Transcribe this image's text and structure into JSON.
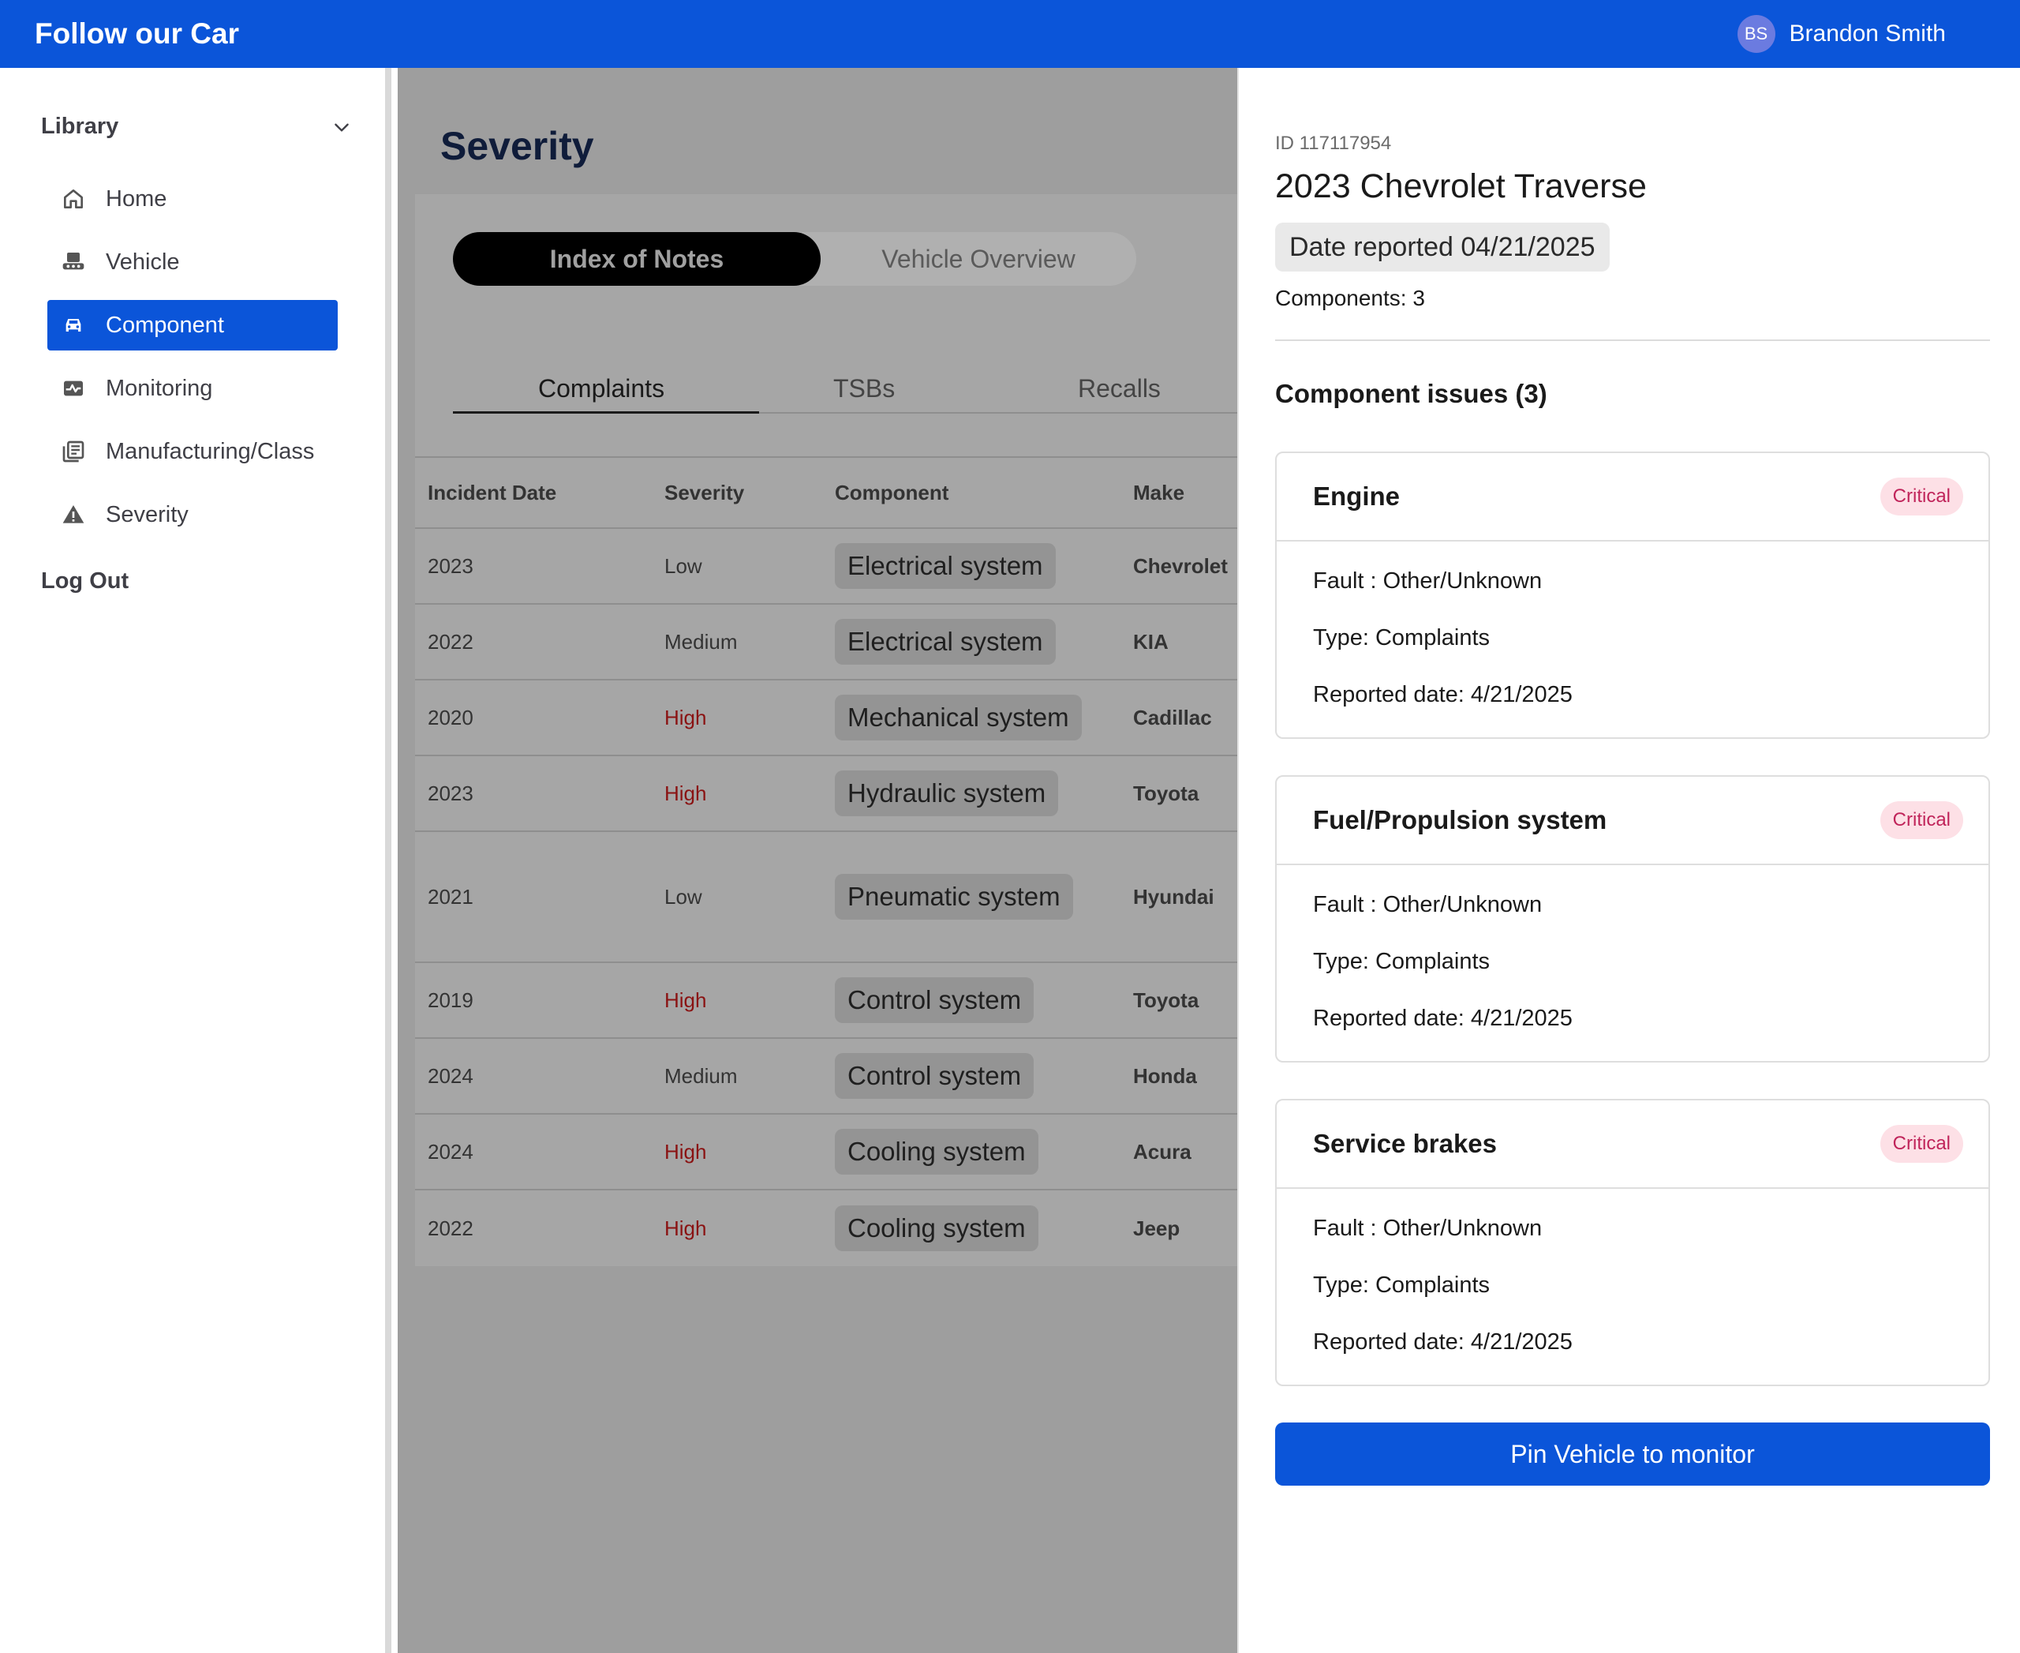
{
  "app": {
    "title": "Follow our Car"
  },
  "user": {
    "initials": "BS",
    "name": "Brandon Smith"
  },
  "sidebar": {
    "section_title": "Library",
    "items": [
      {
        "label": "Home",
        "icon": "home-icon"
      },
      {
        "label": "Vehicle",
        "icon": "vehicle-icon"
      },
      {
        "label": "Component",
        "icon": "car-icon",
        "active": true
      },
      {
        "label": "Monitoring",
        "icon": "monitoring-icon"
      },
      {
        "label": "Manufacturing/Class",
        "icon": "library-icon"
      },
      {
        "label": "Severity",
        "icon": "warning-icon"
      }
    ],
    "logout": "Log Out"
  },
  "main": {
    "title": "Severity",
    "segment": {
      "active": "Index of Notes",
      "inactive": "Vehicle Overview"
    },
    "tabs": [
      "Complaints",
      "TSBs",
      "Recalls"
    ],
    "columns": [
      "Incident Date",
      "Severity",
      "Component",
      "Make"
    ],
    "rows": [
      {
        "date": "2023",
        "severity": "Low",
        "component": "Electrical system",
        "make": "Chevrolet"
      },
      {
        "date": "2022",
        "severity": "Medium",
        "component": "Electrical system",
        "make": "KIA"
      },
      {
        "date": "2020",
        "severity": "High",
        "component": "Mechanical system",
        "make": "Cadillac"
      },
      {
        "date": "2023",
        "severity": "High",
        "component": "Hydraulic system",
        "make": "Toyota"
      },
      {
        "date": "2021",
        "severity": "Low",
        "component": "Pneumatic system",
        "make": "Hyundai"
      },
      {
        "date": "2019",
        "severity": "High",
        "component": "Control system",
        "make": "Toyota"
      },
      {
        "date": "2024",
        "severity": "Medium",
        "component": "Control system",
        "make": "Honda"
      },
      {
        "date": "2024",
        "severity": "High",
        "component": "Cooling system",
        "make": "Acura"
      },
      {
        "date": "2022",
        "severity": "High",
        "component": "Cooling system",
        "make": "Jeep"
      }
    ]
  },
  "drawer": {
    "id": "ID 117117954",
    "title": "2023 Chevrolet Traverse",
    "date_reported": "Date reported 04/21/2025",
    "components": "Components: 3",
    "issues_title": "Component issues (3)",
    "issues": [
      {
        "title": "Engine",
        "badge": "Critical",
        "fault": "Fault : Other/Unknown",
        "type": "Type: Complaints",
        "reported": "Reported date: 4/21/2025"
      },
      {
        "title": "Fuel/Propulsion system",
        "badge": "Critical",
        "fault": "Fault : Other/Unknown",
        "type": "Type: Complaints",
        "reported": "Reported date: 4/21/2025"
      },
      {
        "title": "Service brakes",
        "badge": "Critical",
        "fault": "Fault : Other/Unknown",
        "type": "Type: Complaints",
        "reported": "Reported date: 4/21/2025"
      }
    ],
    "pin_button": "Pin Vehicle to monitor"
  },
  "colors": {
    "brand": "#0b55d9",
    "high": "#8a1212",
    "critical_badge_bg": "#fde0e6",
    "critical_badge_text": "#c0245a"
  }
}
